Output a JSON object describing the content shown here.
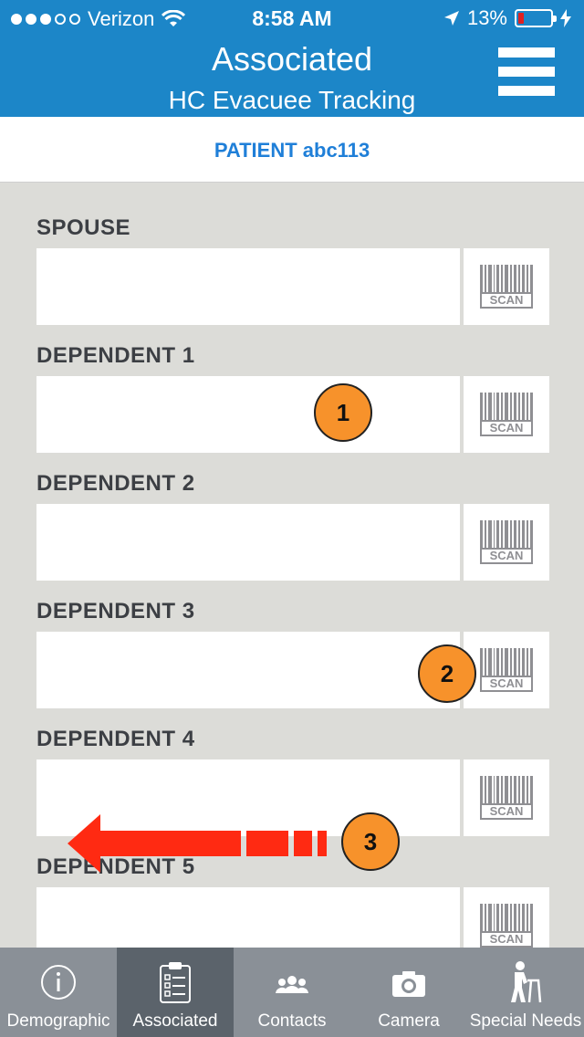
{
  "status_bar": {
    "carrier": "Verizon",
    "time": "8:58 AM",
    "battery": "13%",
    "signal_bars_filled": 3,
    "signal_bars_total": 5,
    "battery_level": 0.13
  },
  "header": {
    "title": "Associated",
    "subtitle": "HC Evacuee Tracking",
    "background": "#1c86c8"
  },
  "patient": {
    "label": "PATIENT abc113",
    "color": "#1f7fd8"
  },
  "fields": [
    {
      "label": "SPOUSE",
      "value": "",
      "scan_label": "SCAN"
    },
    {
      "label": "DEPENDENT 1",
      "value": "",
      "scan_label": "SCAN"
    },
    {
      "label": "DEPENDENT 2",
      "value": "",
      "scan_label": "SCAN"
    },
    {
      "label": "DEPENDENT 3",
      "value": "",
      "scan_label": "SCAN"
    },
    {
      "label": "DEPENDENT 4",
      "value": "",
      "scan_label": "SCAN"
    },
    {
      "label": "DEPENDENT 5",
      "value": "",
      "scan_label": "SCAN"
    }
  ],
  "annotations": {
    "marker_1": "1",
    "marker_2": "2",
    "marker_3": "3",
    "marker_color": "#f7922b",
    "arrow_color": "#ff2a12"
  },
  "tabs": [
    {
      "label": "Demographic",
      "icon": "info-icon",
      "active": false
    },
    {
      "label": "Associated",
      "icon": "clipboard-checklist-icon",
      "active": true
    },
    {
      "label": "Contacts",
      "icon": "people-group-icon",
      "active": false
    },
    {
      "label": "Camera",
      "icon": "camera-icon",
      "active": false
    },
    {
      "label": "Special Needs",
      "icon": "walker-person-icon",
      "active": false
    }
  ]
}
